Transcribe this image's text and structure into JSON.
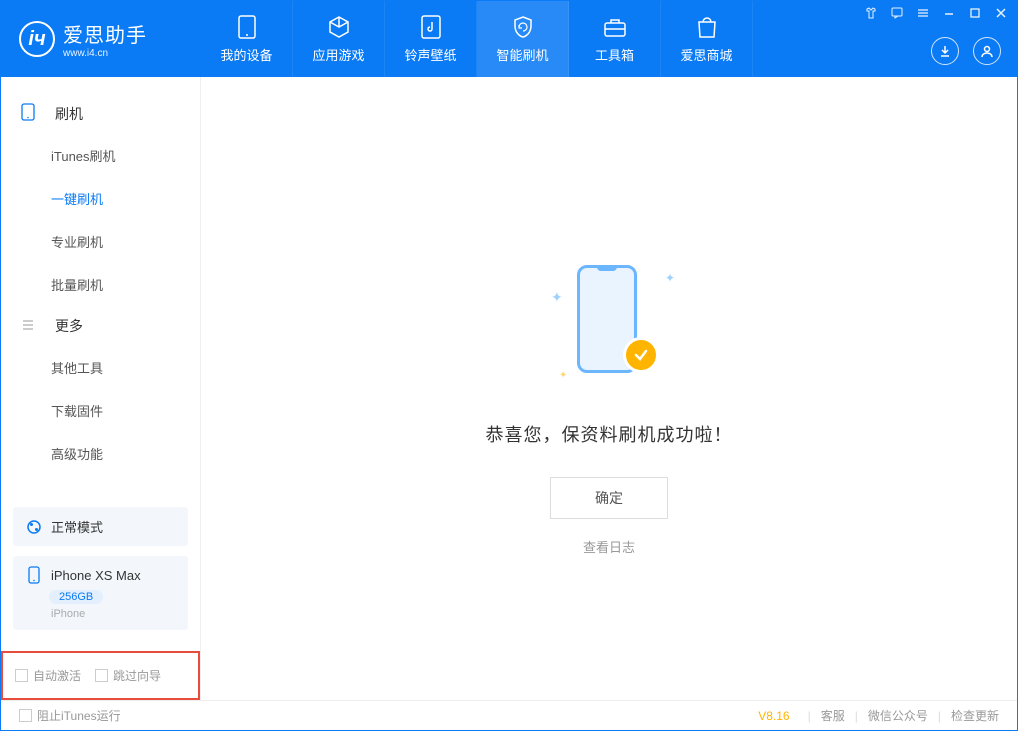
{
  "app": {
    "title": "爱思助手",
    "subtitle": "www.i4.cn"
  },
  "nav": {
    "tabs": [
      {
        "label": "我的设备"
      },
      {
        "label": "应用游戏"
      },
      {
        "label": "铃声壁纸"
      },
      {
        "label": "智能刷机"
      },
      {
        "label": "工具箱"
      },
      {
        "label": "爱思商城"
      }
    ]
  },
  "sidebar": {
    "section1": {
      "title": "刷机",
      "items": [
        {
          "label": "iTunes刷机"
        },
        {
          "label": "一键刷机"
        },
        {
          "label": "专业刷机"
        },
        {
          "label": "批量刷机"
        }
      ]
    },
    "section2": {
      "title": "更多",
      "items": [
        {
          "label": "其他工具"
        },
        {
          "label": "下载固件"
        },
        {
          "label": "高级功能"
        }
      ]
    },
    "mode_card": {
      "label": "正常模式"
    },
    "device_card": {
      "name": "iPhone XS Max",
      "storage": "256GB",
      "type": "iPhone"
    },
    "checks": {
      "auto_activate": "自动激活",
      "skip_guide": "跳过向导"
    }
  },
  "main": {
    "success_text": "恭喜您，保资料刷机成功啦！",
    "ok_button": "确定",
    "log_link": "查看日志"
  },
  "footer": {
    "block_itunes": "阻止iTunes运行",
    "version": "V8.16",
    "links": {
      "service": "客服",
      "wechat": "微信公众号",
      "update": "检查更新"
    }
  }
}
